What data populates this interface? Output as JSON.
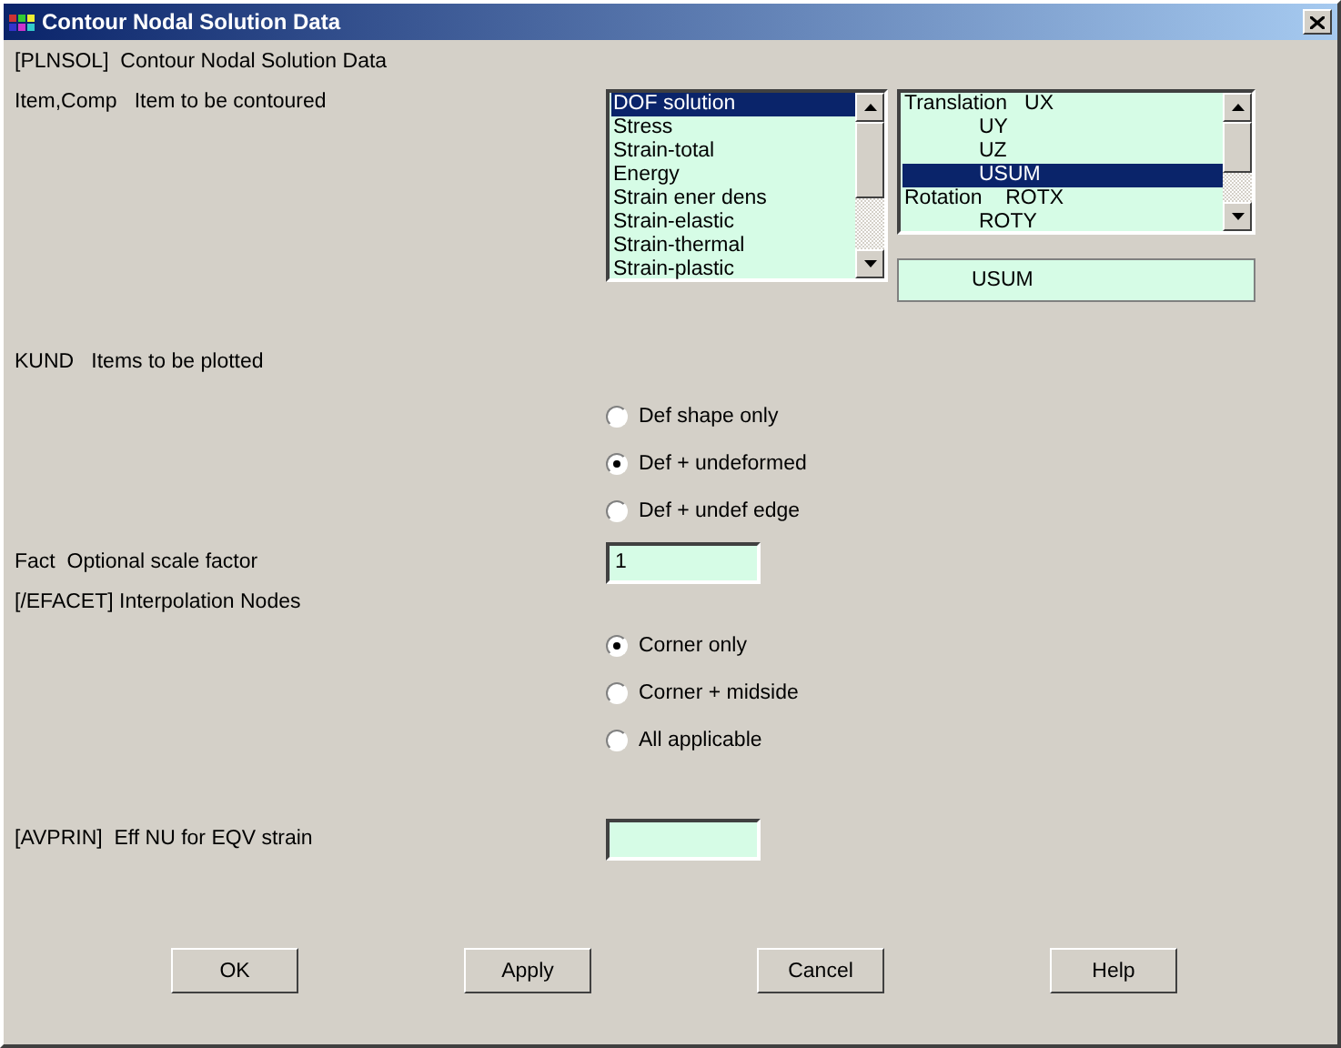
{
  "window": {
    "title": "Contour Nodal Solution Data"
  },
  "heading": "[PLNSOL]  Contour Nodal Solution Data",
  "item_comp": {
    "label": "Item,Comp   Item to be contoured",
    "items": [
      {
        "text": "DOF solution",
        "selected": true
      },
      {
        "text": "Stress",
        "selected": false
      },
      {
        "text": "Strain-total",
        "selected": false
      },
      {
        "text": "Energy",
        "selected": false
      },
      {
        "text": "Strain ener dens",
        "selected": false
      },
      {
        "text": "Strain-elastic",
        "selected": false
      },
      {
        "text": "Strain-thermal",
        "selected": false
      },
      {
        "text": "Strain-plastic",
        "selected": false
      }
    ],
    "components": [
      {
        "kind": "head",
        "text": "Translation   UX",
        "selected": false
      },
      {
        "kind": "sub",
        "text": "UY",
        "selected": false
      },
      {
        "kind": "sub",
        "text": "UZ",
        "selected": false
      },
      {
        "kind": "sub",
        "text": "USUM",
        "selected": true
      },
      {
        "kind": "head",
        "text": "Rotation    ROTX",
        "selected": false
      },
      {
        "kind": "sub",
        "text": "ROTY",
        "selected": false
      }
    ],
    "value": "USUM"
  },
  "kund": {
    "label": "KUND   Items to be plotted",
    "options": [
      {
        "label": "Def shape only",
        "selected": false
      },
      {
        "label": "Def + undeformed",
        "selected": true
      },
      {
        "label": "Def + undef edge",
        "selected": false
      }
    ]
  },
  "fact": {
    "label": "Fact  Optional scale factor",
    "value": "1"
  },
  "efacet": {
    "label": "[/EFACET] Interpolation Nodes",
    "options": [
      {
        "label": "Corner only",
        "selected": true
      },
      {
        "label": "Corner + midside",
        "selected": false
      },
      {
        "label": "All applicable",
        "selected": false
      }
    ]
  },
  "avprin": {
    "label": "[AVPRIN]  Eff NU for EQV strain"
  },
  "buttons": [
    "OK",
    "Apply",
    "Cancel",
    "Help"
  ]
}
